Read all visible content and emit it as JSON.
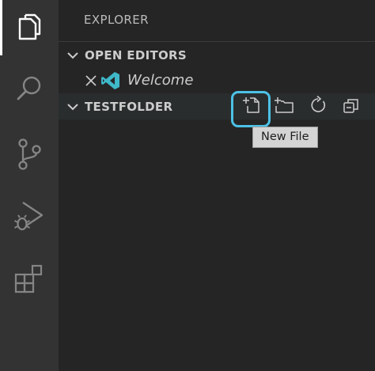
{
  "theme": {
    "activity_bar_bg": "#333333",
    "sidebar_bg": "#252526",
    "highlight": "#4cc1e6",
    "vscode_logo": "#3fb8c9"
  },
  "activity_bar": {
    "items": [
      {
        "icon": "files-icon",
        "active": true
      },
      {
        "icon": "search-icon",
        "active": false
      },
      {
        "icon": "source-control-icon",
        "active": false
      },
      {
        "icon": "run-debug-icon",
        "active": false
      },
      {
        "icon": "extensions-icon",
        "active": false
      }
    ]
  },
  "sidebar": {
    "title": "EXPLORER",
    "open_editors": {
      "label": "OPEN EDITORS",
      "items": [
        {
          "label": "Welcome",
          "icon": "vscode-logo-icon"
        }
      ]
    },
    "folder": {
      "label": "TESTFOLDER",
      "actions": [
        {
          "name": "new-file",
          "icon": "new-file-icon"
        },
        {
          "name": "new-folder",
          "icon": "new-folder-icon"
        },
        {
          "name": "refresh",
          "icon": "refresh-icon"
        },
        {
          "name": "collapse-all",
          "icon": "collapse-all-icon"
        }
      ]
    }
  },
  "tooltip": {
    "text": "New File"
  }
}
